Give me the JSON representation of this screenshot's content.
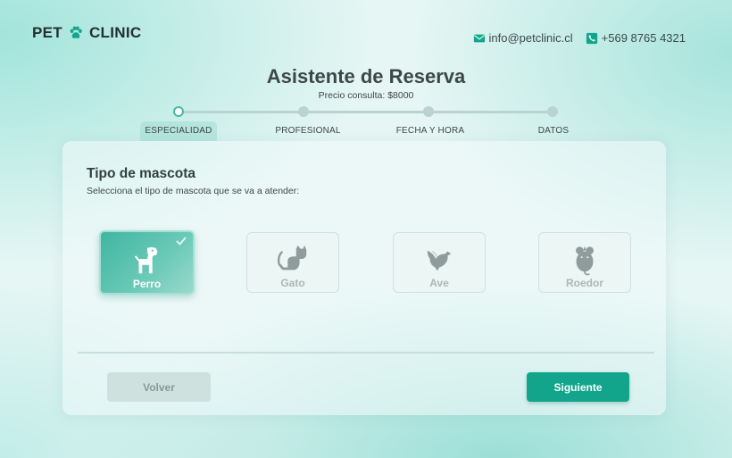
{
  "header": {
    "logo_left": "PET",
    "logo_right": "CLINIC",
    "email": "info@petclinic.cl",
    "phone": "+569 8765 4321"
  },
  "wizard": {
    "title": "Asistente de Reserva",
    "subtitle": "Precio consulta: $8000",
    "steps": [
      {
        "label": "ESPECIALIDAD",
        "active": true
      },
      {
        "label": "PROFESIONAL",
        "active": false
      },
      {
        "label": "FECHA Y HORA",
        "active": false
      },
      {
        "label": "DATOS",
        "active": false
      }
    ]
  },
  "section": {
    "title": "Tipo de mascota",
    "description": "Selecciona el tipo de mascota que se va a atender:"
  },
  "pets": [
    {
      "label": "Perro",
      "icon": "dog-icon",
      "selected": true
    },
    {
      "label": "Gato",
      "icon": "cat-icon",
      "selected": false
    },
    {
      "label": "Ave",
      "icon": "bird-icon",
      "selected": false
    },
    {
      "label": "Roedor",
      "icon": "mouse-icon",
      "selected": false
    }
  ],
  "actions": {
    "back_label": "Volver",
    "next_label": "Siguiente"
  },
  "colors": {
    "accent": "#12a58c",
    "selected_card": "#3fb6a1",
    "disabled": "#cfe1df"
  }
}
